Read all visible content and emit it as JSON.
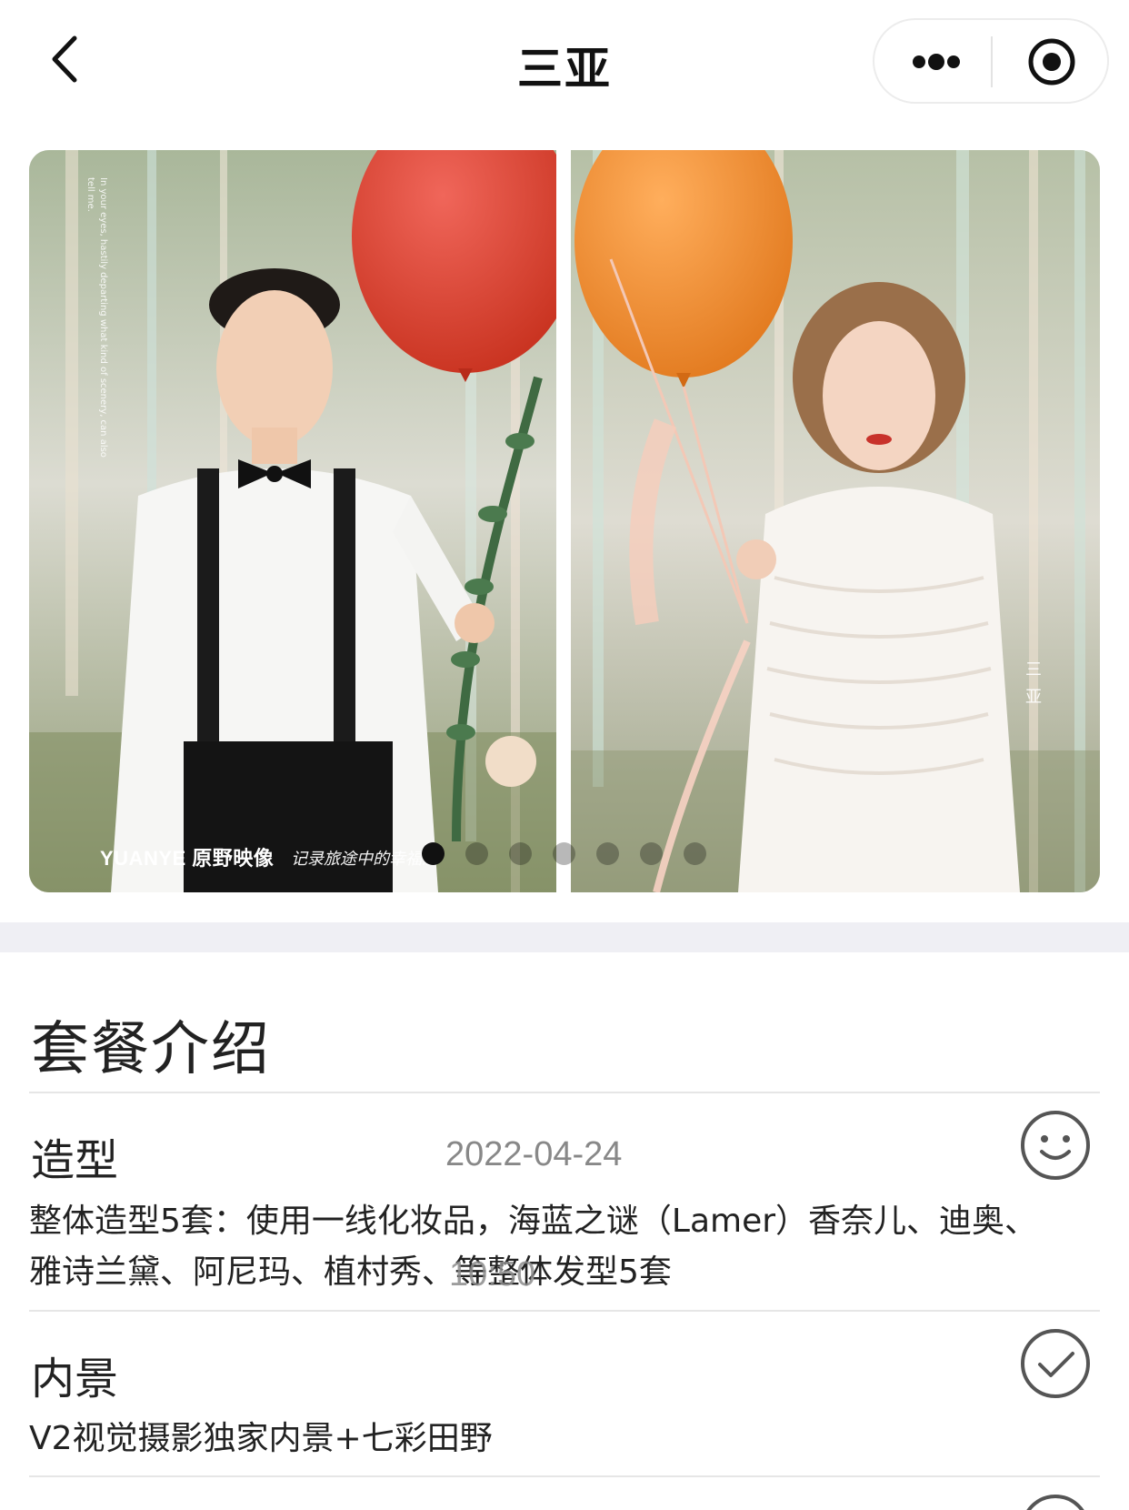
{
  "nav": {
    "title": "三亚",
    "back_icon": "chevron-left-icon",
    "more_icon": "more-dots-icon",
    "close_icon": "target-close-icon"
  },
  "banner": {
    "vertical_text": "In your eyes, hastily departing what kind of scenery, can also tell me.",
    "brand": "YUANYE 原野映像",
    "signature": "记录旅途中的幸福感",
    "side_text": "三亚",
    "dots_total": 7,
    "active_dot": 1
  },
  "package": {
    "section_title": "套餐介绍",
    "items": [
      {
        "title": "造型",
        "date": "2022-04-24",
        "desc": "整体造型5套：使用一线化妆品，海蓝之谜（Lamer）香奈儿、迪奥、雅诗兰黛、阿尼玛、植村秀、等整体发型5套",
        "overlay_time": "10:50",
        "icon": "smiley-icon"
      },
      {
        "title": "内景",
        "desc": "V2视觉摄影独家内景+七彩田野",
        "icon": "check-circle-icon"
      }
    ]
  },
  "colors": {
    "text": "#222222",
    "muted": "#888888",
    "separator": "#efeff4",
    "balloon_red": "#e0452b",
    "balloon_orange": "#f28a2c"
  }
}
